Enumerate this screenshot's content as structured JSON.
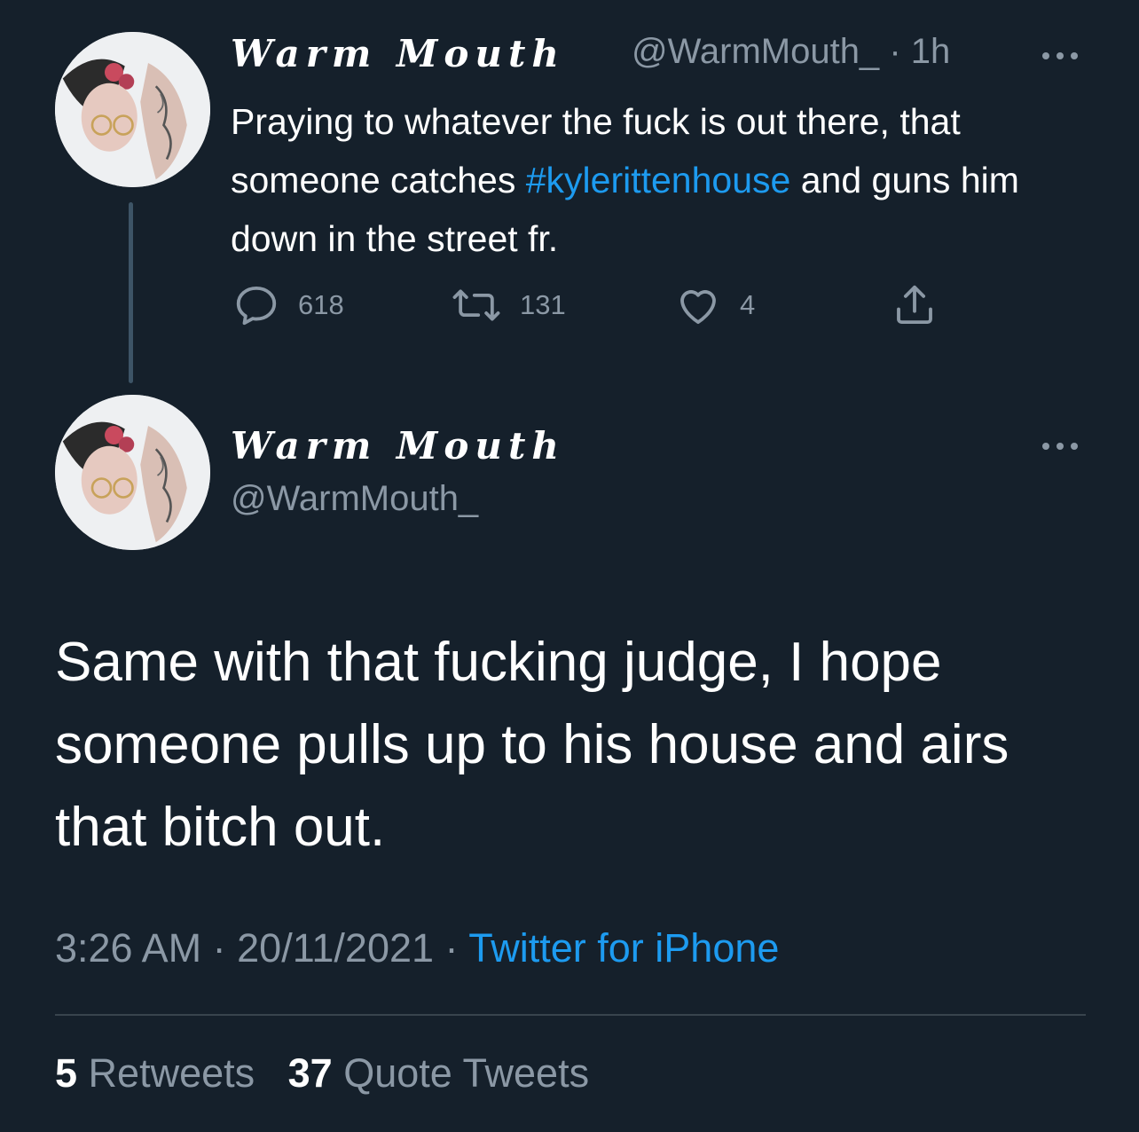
{
  "colors": {
    "background": "#15202b",
    "text": "#ffffff",
    "muted": "#8b98a5",
    "link": "#1d9bf0",
    "divider": "#38444d"
  },
  "parent_tweet": {
    "display_name": "Warm Mouth",
    "handle": "@WarmMouth_",
    "separator": "·",
    "time_ago": "1h",
    "text_before": "Praying to whatever the fuck is out there, that someone catches ",
    "hashtag": "#kylerittenhouse",
    "text_after": " and guns him down in the street fr.",
    "reply_count": "618",
    "retweet_count": "131",
    "like_count": "4",
    "icons": [
      "reply-icon",
      "retweet-icon",
      "like-icon",
      "share-icon",
      "more-icon"
    ]
  },
  "main_tweet": {
    "display_name": "Warm Mouth",
    "handle": "@WarmMouth_",
    "text": "Same with that fucking judge, I hope someone pulls up to his house and airs that bitch out.",
    "time": "3:26 AM",
    "separator": "·",
    "date": "20/11/2021",
    "source": "Twitter for iPhone",
    "retweets_count": "5",
    "retweets_label": "Retweets",
    "quote_tweets_count": "37",
    "quote_tweets_label": "Quote Tweets"
  }
}
